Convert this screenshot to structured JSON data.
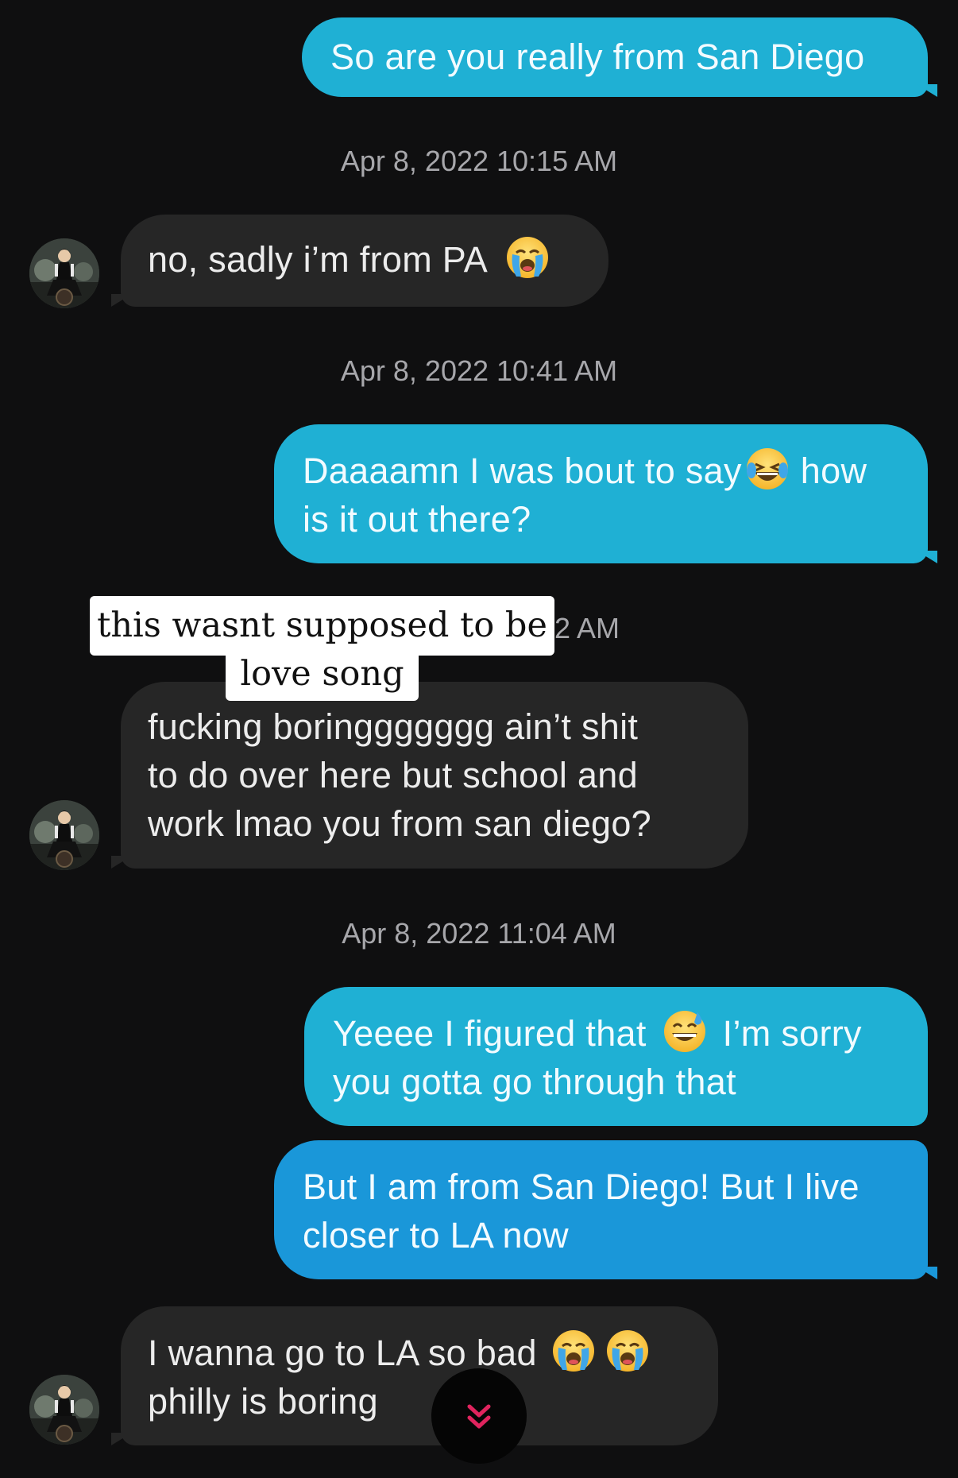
{
  "messages": {
    "m1": "So are you really from San Diego",
    "m2": "no, sadly i’m from PA",
    "m3_part1": "Daaaamn I was bout to say",
    "m3_part2": "how",
    "m3_line2": "is it out there?",
    "m4_line1": "fucking boringgggggg ain’t shit",
    "m4_line2": "to do over here but school and",
    "m4_line3": "work lmao you from san diego?",
    "m5_part1": "Yeeee I figured that",
    "m5_part2": "I’m sorry",
    "m5_line2": "you gotta go through that",
    "m6_line1": "But I am from San Diego! But I live",
    "m6_line2": "closer to LA now",
    "m7_line1": "I wanna go to LA so bad",
    "m7_line2": "philly is boring"
  },
  "timestamps": {
    "t1": "Apr 8, 2022 10:15 AM",
    "t2": "Apr 8, 2022 10:41 AM",
    "t3_visible": "2 AM",
    "t4": "Apr 8, 2022 11:04 AM"
  },
  "sticker": {
    "line1": "this wasnt supposed to be a",
    "line2": "love song"
  },
  "icons": {
    "cry": "loudly-crying-face-emoji",
    "laugh": "face-with-tears-of-joy-emoji",
    "sweat": "grinning-face-with-sweat-emoji",
    "scroll": "double-chevron-down-icon"
  },
  "colors": {
    "background": "#0f0f10",
    "outgoing": "#1fb0d4",
    "outgoing_alt": "#1a97d9",
    "incoming": "#262626",
    "scroll_chevron": "#e0245e"
  }
}
